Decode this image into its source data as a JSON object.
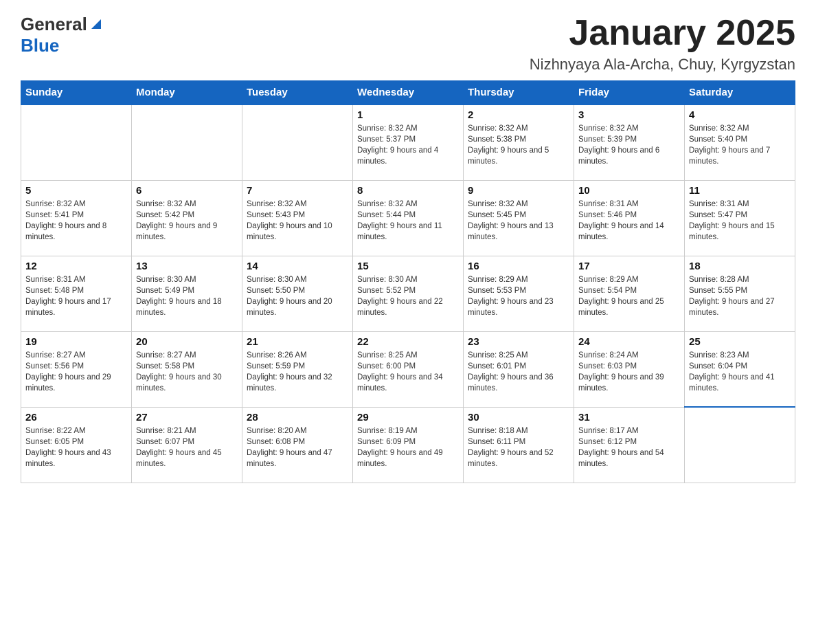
{
  "header": {
    "logo_general": "General",
    "logo_blue": "Blue",
    "title": "January 2025",
    "location": "Nizhnyaya Ala-Archa, Chuy, Kyrgyzstan"
  },
  "days_of_week": [
    "Sunday",
    "Monday",
    "Tuesday",
    "Wednesday",
    "Thursday",
    "Friday",
    "Saturday"
  ],
  "weeks": [
    [
      {
        "day": "",
        "info": ""
      },
      {
        "day": "",
        "info": ""
      },
      {
        "day": "",
        "info": ""
      },
      {
        "day": "1",
        "info": "Sunrise: 8:32 AM\nSunset: 5:37 PM\nDaylight: 9 hours and 4 minutes."
      },
      {
        "day": "2",
        "info": "Sunrise: 8:32 AM\nSunset: 5:38 PM\nDaylight: 9 hours and 5 minutes."
      },
      {
        "day": "3",
        "info": "Sunrise: 8:32 AM\nSunset: 5:39 PM\nDaylight: 9 hours and 6 minutes."
      },
      {
        "day": "4",
        "info": "Sunrise: 8:32 AM\nSunset: 5:40 PM\nDaylight: 9 hours and 7 minutes."
      }
    ],
    [
      {
        "day": "5",
        "info": "Sunrise: 8:32 AM\nSunset: 5:41 PM\nDaylight: 9 hours and 8 minutes."
      },
      {
        "day": "6",
        "info": "Sunrise: 8:32 AM\nSunset: 5:42 PM\nDaylight: 9 hours and 9 minutes."
      },
      {
        "day": "7",
        "info": "Sunrise: 8:32 AM\nSunset: 5:43 PM\nDaylight: 9 hours and 10 minutes."
      },
      {
        "day": "8",
        "info": "Sunrise: 8:32 AM\nSunset: 5:44 PM\nDaylight: 9 hours and 11 minutes."
      },
      {
        "day": "9",
        "info": "Sunrise: 8:32 AM\nSunset: 5:45 PM\nDaylight: 9 hours and 13 minutes."
      },
      {
        "day": "10",
        "info": "Sunrise: 8:31 AM\nSunset: 5:46 PM\nDaylight: 9 hours and 14 minutes."
      },
      {
        "day": "11",
        "info": "Sunrise: 8:31 AM\nSunset: 5:47 PM\nDaylight: 9 hours and 15 minutes."
      }
    ],
    [
      {
        "day": "12",
        "info": "Sunrise: 8:31 AM\nSunset: 5:48 PM\nDaylight: 9 hours and 17 minutes."
      },
      {
        "day": "13",
        "info": "Sunrise: 8:30 AM\nSunset: 5:49 PM\nDaylight: 9 hours and 18 minutes."
      },
      {
        "day": "14",
        "info": "Sunrise: 8:30 AM\nSunset: 5:50 PM\nDaylight: 9 hours and 20 minutes."
      },
      {
        "day": "15",
        "info": "Sunrise: 8:30 AM\nSunset: 5:52 PM\nDaylight: 9 hours and 22 minutes."
      },
      {
        "day": "16",
        "info": "Sunrise: 8:29 AM\nSunset: 5:53 PM\nDaylight: 9 hours and 23 minutes."
      },
      {
        "day": "17",
        "info": "Sunrise: 8:29 AM\nSunset: 5:54 PM\nDaylight: 9 hours and 25 minutes."
      },
      {
        "day": "18",
        "info": "Sunrise: 8:28 AM\nSunset: 5:55 PM\nDaylight: 9 hours and 27 minutes."
      }
    ],
    [
      {
        "day": "19",
        "info": "Sunrise: 8:27 AM\nSunset: 5:56 PM\nDaylight: 9 hours and 29 minutes."
      },
      {
        "day": "20",
        "info": "Sunrise: 8:27 AM\nSunset: 5:58 PM\nDaylight: 9 hours and 30 minutes."
      },
      {
        "day": "21",
        "info": "Sunrise: 8:26 AM\nSunset: 5:59 PM\nDaylight: 9 hours and 32 minutes."
      },
      {
        "day": "22",
        "info": "Sunrise: 8:25 AM\nSunset: 6:00 PM\nDaylight: 9 hours and 34 minutes."
      },
      {
        "day": "23",
        "info": "Sunrise: 8:25 AM\nSunset: 6:01 PM\nDaylight: 9 hours and 36 minutes."
      },
      {
        "day": "24",
        "info": "Sunrise: 8:24 AM\nSunset: 6:03 PM\nDaylight: 9 hours and 39 minutes."
      },
      {
        "day": "25",
        "info": "Sunrise: 8:23 AM\nSunset: 6:04 PM\nDaylight: 9 hours and 41 minutes."
      }
    ],
    [
      {
        "day": "26",
        "info": "Sunrise: 8:22 AM\nSunset: 6:05 PM\nDaylight: 9 hours and 43 minutes."
      },
      {
        "day": "27",
        "info": "Sunrise: 8:21 AM\nSunset: 6:07 PM\nDaylight: 9 hours and 45 minutes."
      },
      {
        "day": "28",
        "info": "Sunrise: 8:20 AM\nSunset: 6:08 PM\nDaylight: 9 hours and 47 minutes."
      },
      {
        "day": "29",
        "info": "Sunrise: 8:19 AM\nSunset: 6:09 PM\nDaylight: 9 hours and 49 minutes."
      },
      {
        "day": "30",
        "info": "Sunrise: 8:18 AM\nSunset: 6:11 PM\nDaylight: 9 hours and 52 minutes."
      },
      {
        "day": "31",
        "info": "Sunrise: 8:17 AM\nSunset: 6:12 PM\nDaylight: 9 hours and 54 minutes."
      },
      {
        "day": "",
        "info": ""
      }
    ]
  ]
}
